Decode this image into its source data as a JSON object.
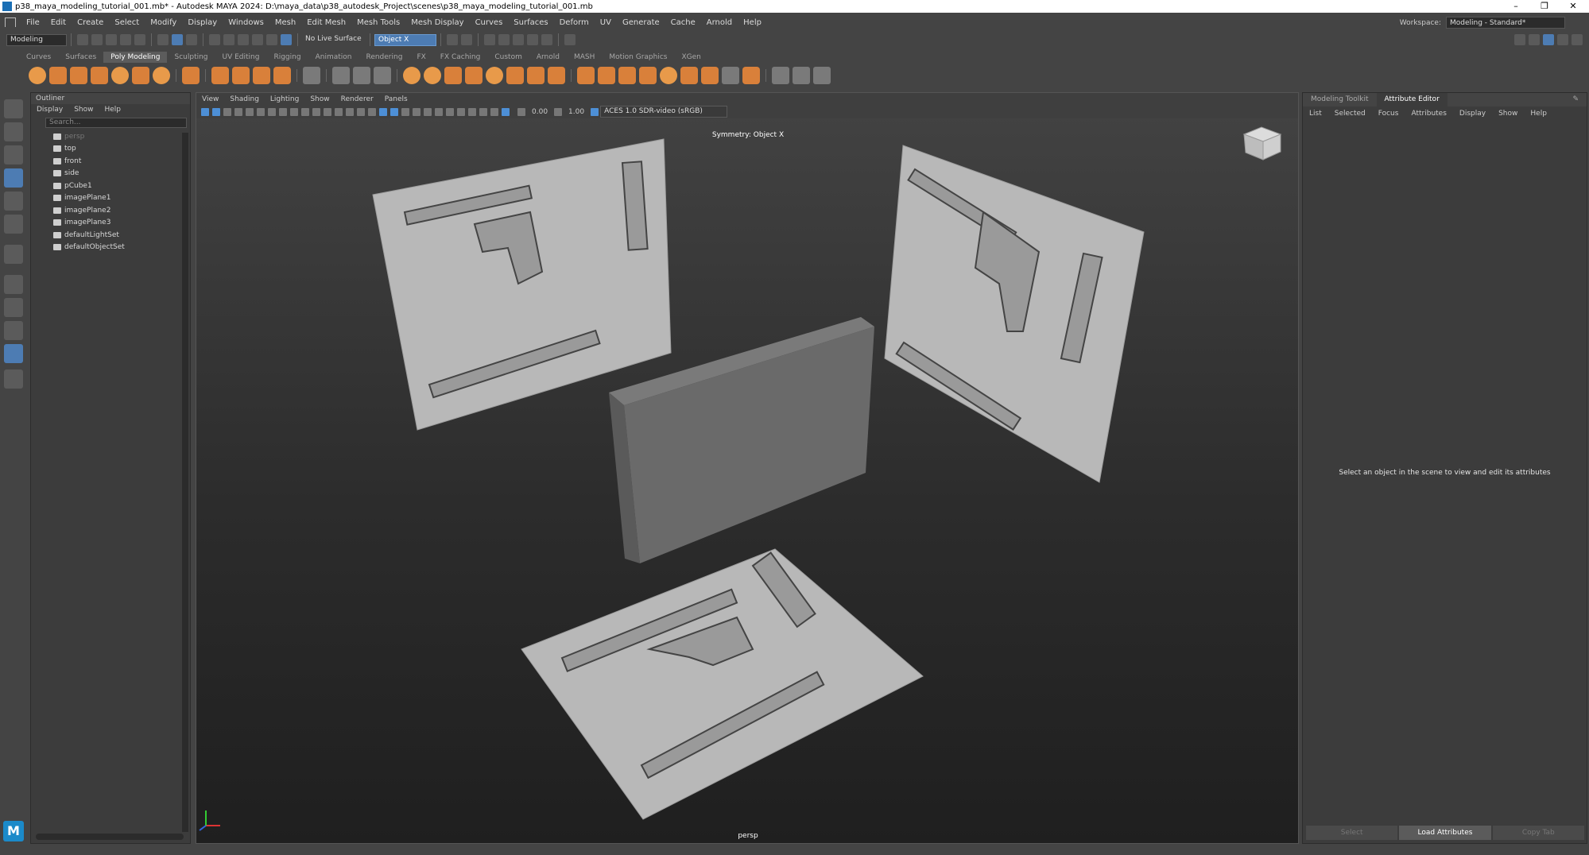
{
  "window": {
    "title": "p38_maya_modeling_tutorial_001.mb* - Autodesk MAYA 2024: D:\\maya_data\\p38_autodesk_Project\\scenes\\p38_maya_modeling_tutorial_001.mb",
    "minimize": "–",
    "maximize": "❐",
    "close": "✕"
  },
  "menubar": {
    "items": [
      "File",
      "Edit",
      "Create",
      "Select",
      "Modify",
      "Display",
      "Windows",
      "Mesh",
      "Edit Mesh",
      "Mesh Tools",
      "Mesh Display",
      "Curves",
      "Surfaces",
      "Deform",
      "UV",
      "Generate",
      "Cache",
      "Arnold",
      "Help"
    ],
    "workspace_label": "Workspace:",
    "workspace_value": "Modeling - Standard*"
  },
  "statusline": {
    "mode": "Modeling",
    "live_surface": "No Live Surface",
    "symmetry": "Object X"
  },
  "shelf": {
    "tabs": [
      "Curves",
      "Surfaces",
      "Poly Modeling",
      "Sculpting",
      "UV Editing",
      "Rigging",
      "Animation",
      "Rendering",
      "FX",
      "FX Caching",
      "Custom",
      "Arnold",
      "MASH",
      "Motion Graphics",
      "XGen"
    ],
    "active_tab": "Poly Modeling"
  },
  "outliner": {
    "title": "Outliner",
    "menu": [
      "Display",
      "Show",
      "Help"
    ],
    "search_placeholder": "Search...",
    "items": [
      {
        "label": "persp",
        "icon": "camera-icon",
        "dim": true
      },
      {
        "label": "top",
        "icon": "camera-icon",
        "dim": false
      },
      {
        "label": "front",
        "icon": "camera-icon",
        "dim": false
      },
      {
        "label": "side",
        "icon": "camera-icon",
        "dim": false
      },
      {
        "label": "pCube1",
        "icon": "mesh-icon",
        "dim": false
      },
      {
        "label": "imagePlane1",
        "icon": "image-plane-icon",
        "dim": false
      },
      {
        "label": "imagePlane2",
        "icon": "image-plane-icon",
        "dim": false
      },
      {
        "label": "imagePlane3",
        "icon": "image-plane-icon",
        "dim": false
      },
      {
        "label": "defaultLightSet",
        "icon": "set-icon",
        "dim": false
      },
      {
        "label": "defaultObjectSet",
        "icon": "set-icon",
        "dim": false
      }
    ]
  },
  "viewport": {
    "menu": [
      "View",
      "Shading",
      "Lighting",
      "Show",
      "Renderer",
      "Panels"
    ],
    "exposure": "0.00",
    "gamma": "1.00",
    "color_space": "ACES 1.0 SDR-video (sRGB)",
    "symmetry_label": "Symmetry: Object X",
    "camera": "persp"
  },
  "attribute_editor": {
    "tabs": [
      "Modeling Toolkit",
      "Attribute Editor"
    ],
    "active_tab": "Attribute Editor",
    "menu": [
      "List",
      "Selected",
      "Focus",
      "Attributes",
      "Display",
      "Show",
      "Help"
    ],
    "message": "Select an object in the scene to view and edit its attributes",
    "buttons": [
      "Select",
      "Load Attributes",
      "Copy Tab"
    ]
  },
  "colors": {
    "accent": "#4d7cb3",
    "shelf_icon": "#d9803a",
    "panel_bg": "#3c3c3c",
    "image_plane": "#b9b9b9",
    "cube_face": "#6a6a6a"
  }
}
